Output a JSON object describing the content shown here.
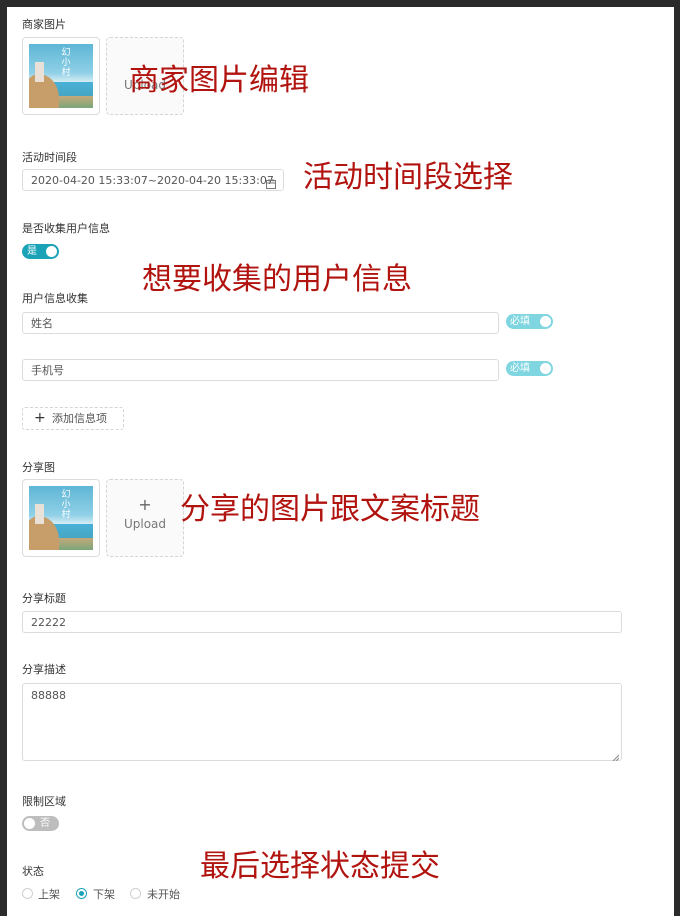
{
  "merchant_images": {
    "label": "商家图片",
    "upload_label": "Upload",
    "thumb_text": "幻小村"
  },
  "activity_period": {
    "label": "活动时间段",
    "value": "2020-04-20 15:33:07~2020-04-20 15:33:07",
    "icon": "calendar-icon"
  },
  "collect_info": {
    "label": "是否收集用户信息",
    "toggle_text": "是",
    "on": true
  },
  "user_info": {
    "label": "用户信息收集",
    "fields": [
      {
        "value": "姓名",
        "required_label": "必填",
        "required_on": true
      },
      {
        "value": "手机号",
        "required_label": "必填",
        "required_on": true
      }
    ],
    "add_button": "添加信息项"
  },
  "share_image": {
    "label": "分享图",
    "upload_label": "Upload",
    "thumb_text": "幻小村"
  },
  "share_title": {
    "label": "分享标题",
    "value": "22222"
  },
  "share_desc": {
    "label": "分享描述",
    "value": "88888"
  },
  "region_limit": {
    "label": "限制区域",
    "toggle_text": "否",
    "on": false
  },
  "status": {
    "label": "状态",
    "options": [
      {
        "label": "上架",
        "selected": false
      },
      {
        "label": "下架",
        "selected": true
      },
      {
        "label": "未开始",
        "selected": false
      }
    ]
  },
  "annotations": {
    "merchant_edit": "商家图片编辑",
    "period_select": "活动时间段选择",
    "info_collect": "想要收集的用户信息",
    "share_desc": "分享的图片跟文案标题",
    "final_status": "最后选择状态提交"
  },
  "colors": {
    "accent": "#1aa3b7",
    "required_toggle": "#7fd6e0",
    "annotation": "#b1130f",
    "toggle_off": "#bdbdbd"
  }
}
